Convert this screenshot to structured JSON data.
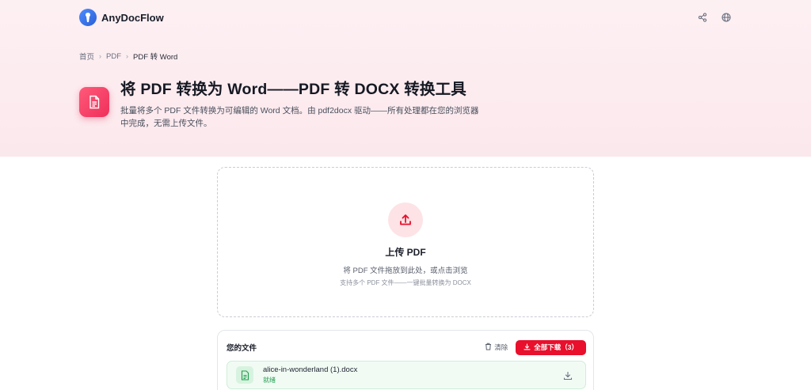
{
  "header": {
    "brand": "AnyDocFlow",
    "icons": [
      "share-icon",
      "globe-icon"
    ]
  },
  "breadcrumb": {
    "items": [
      "首页",
      "PDF",
      "PDF 转 Word"
    ]
  },
  "hero": {
    "title": "将 PDF 转换为 Word——PDF 转 DOCX 转换工具",
    "description": "批量将多个 PDF 文件转换为可编辑的 Word 文档。由 pdf2docx 驱动——所有处理都在您的浏览器中完成，无需上传文件。"
  },
  "upload": {
    "title": "上传 PDF",
    "subtitle": "将 PDF 文件拖放到此处，或点击浏览",
    "hint": "支持多个 PDF 文件——一键批量转换为 DOCX"
  },
  "files": {
    "title": "您的文件",
    "clear_label": "清除",
    "download_all_label": "全部下载（3）",
    "items": [
      {
        "name": "alice-in-wonderland (1).docx",
        "status": "就绪"
      }
    ]
  },
  "colors": {
    "accent": "#e8102c",
    "tool_icon": "#ef2f5a",
    "success": "#1f9d4d"
  }
}
